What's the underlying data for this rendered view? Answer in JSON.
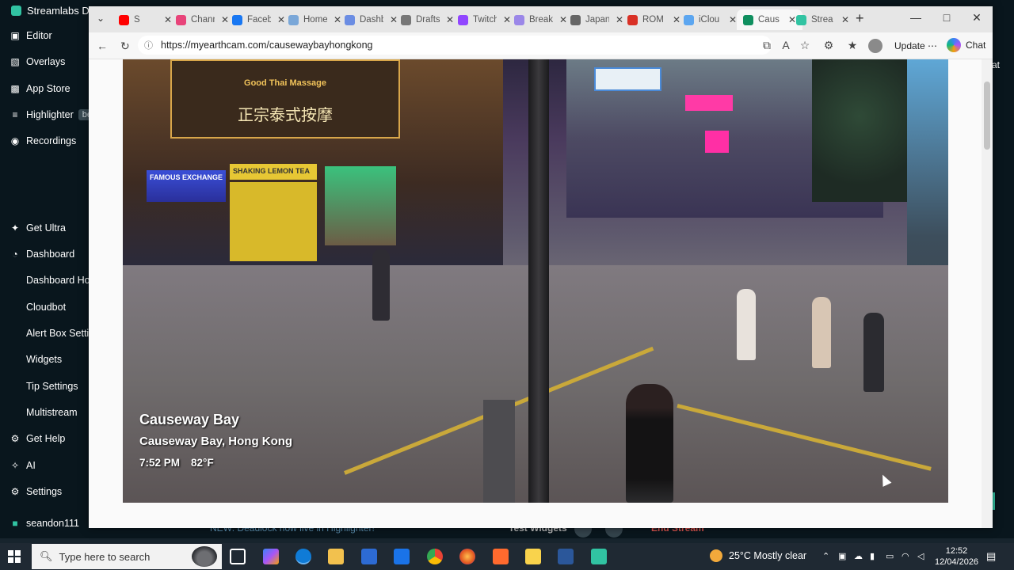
{
  "streamlabs": {
    "title": "Streamlabs De",
    "menu": [
      {
        "label": "Editor",
        "icon": "editor-icon"
      },
      {
        "label": "Overlays",
        "icon": "overlays-icon"
      },
      {
        "label": "App Store",
        "icon": "app-store-icon"
      },
      {
        "label": "Highlighter",
        "icon": "highlighter-icon",
        "badge": "be"
      },
      {
        "label": "Recordings",
        "icon": "recordings-icon"
      },
      {
        "label": "Get Ultra",
        "icon": "ultra-icon"
      },
      {
        "label": "Dashboard",
        "icon": "dashboard-icon"
      },
      {
        "label": "Dashboard Hor"
      },
      {
        "label": "Cloudbot"
      },
      {
        "label": "Alert Box Settin"
      },
      {
        "label": "Widgets"
      },
      {
        "label": "Tip Settings"
      },
      {
        "label": "Multistream"
      },
      {
        "label": "Get Help",
        "icon": "help-icon"
      },
      {
        "label": "AI",
        "icon": "ai-icon"
      },
      {
        "label": "Settings",
        "icon": "settings-icon"
      },
      {
        "label": "seandon111",
        "icon": "user-icon"
      }
    ],
    "right_hint": "at",
    "bottom_strip": {
      "news": "NEW: Deadlock now live in Highlighter!",
      "test_widgets": "Test Widgets",
      "end_stream": "End Stream"
    }
  },
  "browser": {
    "tabs": [
      {
        "title": "S",
        "favicon_color": "#ff0000"
      },
      {
        "title": "Chann",
        "favicon_color": "#e8447a"
      },
      {
        "title": "Faceb",
        "favicon_color": "#1877f2"
      },
      {
        "title": "Home",
        "favicon_color": "#7aa7d8"
      },
      {
        "title": "Dashb",
        "favicon_color": "#6b8de3"
      },
      {
        "title": "Drafts",
        "favicon_color": "#777777"
      },
      {
        "title": "Twitch",
        "favicon_color": "#9146ff"
      },
      {
        "title": "Break",
        "favicon_color": "#9b87e8"
      },
      {
        "title": "Japan",
        "favicon_color": "#666666"
      },
      {
        "title": "ROM",
        "favicon_color": "#d93025"
      },
      {
        "title": "iClou",
        "favicon_color": "#5ca6f0"
      },
      {
        "title": "Caus",
        "favicon_color": "#0f8f5f",
        "active": true
      },
      {
        "title": "Strea",
        "favicon_color": "#31c3a2"
      }
    ],
    "url": "https://myearthcam.com/causewaybayhongkong",
    "update_label": "Update",
    "chat_label": "Chat"
  },
  "webcam": {
    "location_title": "Causeway Bay",
    "location_subtitle": "Causeway Bay, Hong Kong",
    "time": "7:52 PM",
    "temperature": "82°F",
    "signs": [
      "Good Thai Massage",
      "正宗泰式按摩",
      "FAMOUS EXCHANGE",
      "SHAKING LEMON TEA"
    ]
  },
  "taskbar": {
    "search_placeholder": "Type here to search",
    "weather": "25°C  Mostly clear",
    "time": "12:52",
    "date": "12/04/2026"
  }
}
